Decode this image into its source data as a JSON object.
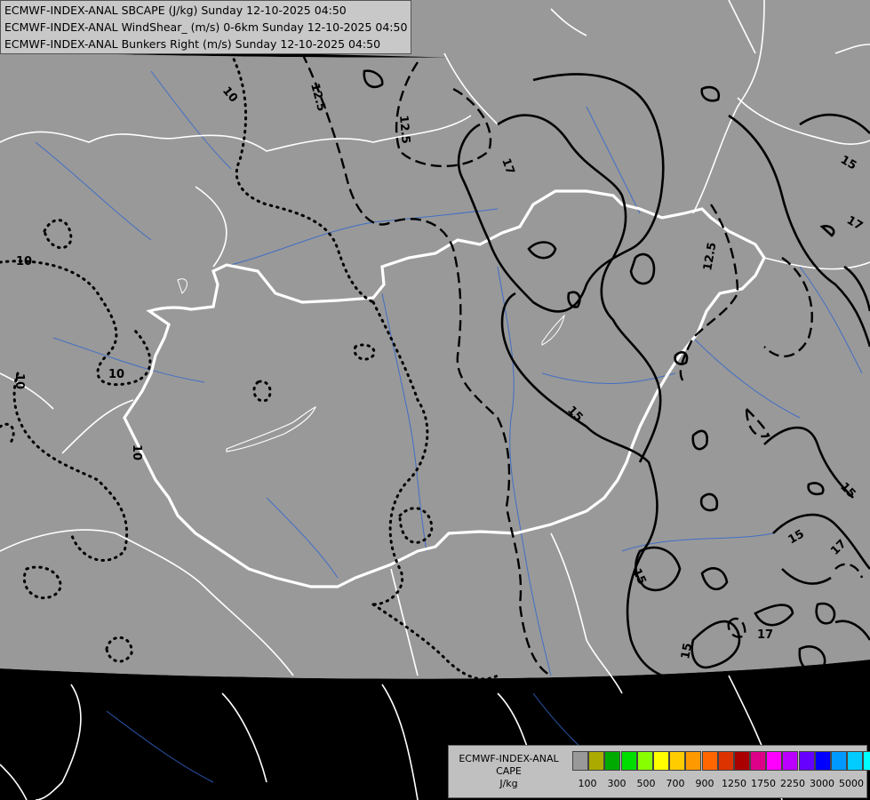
{
  "header": {
    "line1": "ECMWF-INDEX-ANAL SBCAPE (J/kg) Sunday 12-10-2025 04:50",
    "line2": "ECMWF-INDEX-ANAL WindShear_ (m/s) 0-6km Sunday 12-10-2025 04:50",
    "line3": "ECMWF-INDEX-ANAL Bunkers Right (m/s) Sunday 12-10-2025 04:50"
  },
  "legend": {
    "name": "ECMWF-INDEX-ANAL",
    "variable": "CAPE",
    "unit": "J/kg",
    "colors": [
      "#999999",
      "#aaaa00",
      "#00aa00",
      "#00dd00",
      "#88ff00",
      "#ffff00",
      "#ffcc00",
      "#ff9900",
      "#ff6600",
      "#dd3300",
      "#aa0000",
      "#dd0088",
      "#ff00ff",
      "#bb00ff",
      "#6600ff",
      "#0000ff",
      "#0099ff",
      "#00ccff",
      "#00ffff",
      "#ffffff"
    ],
    "ticks": [
      "100",
      "300",
      "500",
      "700",
      "900",
      "1250",
      "1750",
      "2250",
      "3000",
      "5000"
    ]
  },
  "contour_labels": {
    "dotted": [
      "10",
      "10",
      "10",
      "10",
      "10"
    ],
    "dashed": [
      "12.5",
      "12.5",
      "12.5"
    ],
    "solid": [
      "17",
      "15",
      "15",
      "17",
      "15",
      "15",
      "17",
      "17",
      "15",
      "15"
    ]
  }
}
